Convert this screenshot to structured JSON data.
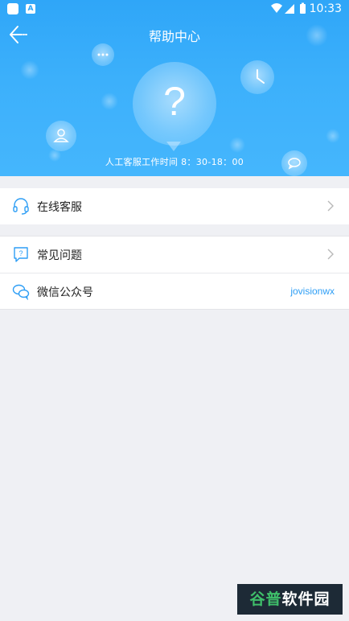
{
  "status_bar": {
    "time": "10:33",
    "a_badge": "A"
  },
  "header": {
    "title": "帮助中心"
  },
  "banner": {
    "question_mark": "?",
    "work_hours": "人工客服工作时间 8：30-18：00"
  },
  "menu": {
    "online_service": {
      "label": "在线客服",
      "icon": "headset-icon"
    },
    "faq": {
      "label": "常见问题",
      "icon": "question-chat-icon"
    },
    "wechat": {
      "label": "微信公众号",
      "icon": "wechat-icon",
      "value": "jovisionwx"
    }
  },
  "watermark": {
    "part1": "谷普",
    "part2": "软件园"
  },
  "colors": {
    "brand_blue": "#2fa6f8",
    "accent_text": "#2e9ef5",
    "background": "#eff0f4"
  }
}
